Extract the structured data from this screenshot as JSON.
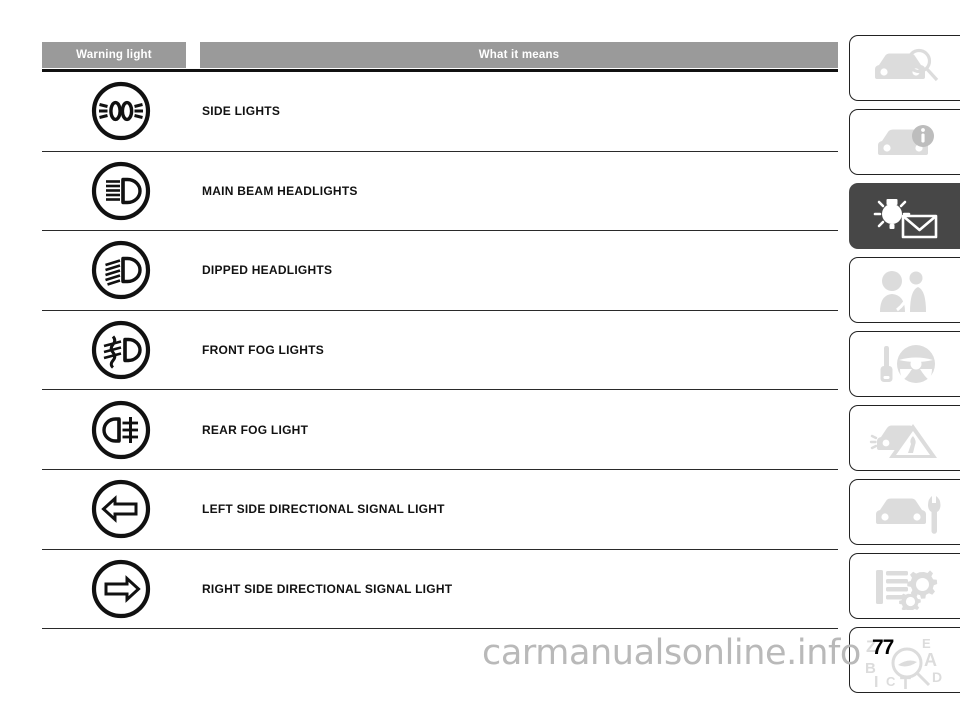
{
  "document": {
    "page_number": "77",
    "watermark": "carmanualsonline.info"
  },
  "table": {
    "headers": {
      "warning_light": "Warning light",
      "what_it_means": "What it means"
    },
    "rows": [
      {
        "icon": "side-lights-icon",
        "label": "SIDE LIGHTS"
      },
      {
        "icon": "main-beam-headlights-icon",
        "label": "MAIN BEAM HEADLIGHTS"
      },
      {
        "icon": "dipped-headlights-icon",
        "label": "DIPPED HEADLIGHTS"
      },
      {
        "icon": "front-fog-lights-icon",
        "label": "FRONT FOG LIGHTS"
      },
      {
        "icon": "rear-fog-light-icon",
        "label": "REAR FOG LIGHT"
      },
      {
        "icon": "left-turn-signal-icon",
        "label": "LEFT SIDE DIRECTIONAL SIGNAL LIGHT"
      },
      {
        "icon": "right-turn-signal-icon",
        "label": "RIGHT SIDE DIRECTIONAL SIGNAL LIGHT"
      }
    ]
  },
  "sidebar": {
    "tabs": [
      {
        "icon": "car-magnifier-icon",
        "active": false
      },
      {
        "icon": "car-info-icon",
        "active": false
      },
      {
        "icon": "warning-light-mail-icon",
        "active": true
      },
      {
        "icon": "airbag-seatbelt-icon",
        "active": false
      },
      {
        "icon": "steering-wheel-key-icon",
        "active": false
      },
      {
        "icon": "emergency-triangle-icon",
        "active": false
      },
      {
        "icon": "car-wrench-icon",
        "active": false
      },
      {
        "icon": "specs-gears-icon",
        "active": false
      },
      {
        "icon": "alphabetical-index-icon",
        "active": false
      }
    ],
    "index_letters": [
      "Z",
      "E",
      "B",
      "A",
      "I",
      "C",
      "T",
      "D"
    ]
  },
  "colors": {
    "header_bg": "#9a9a9a",
    "header_text": "#ffffff",
    "active_tab_bg": "#474747",
    "inactive_icon": "#dcdcdc",
    "rule": "#2a2a2a",
    "watermark": "#b9b9b9"
  }
}
